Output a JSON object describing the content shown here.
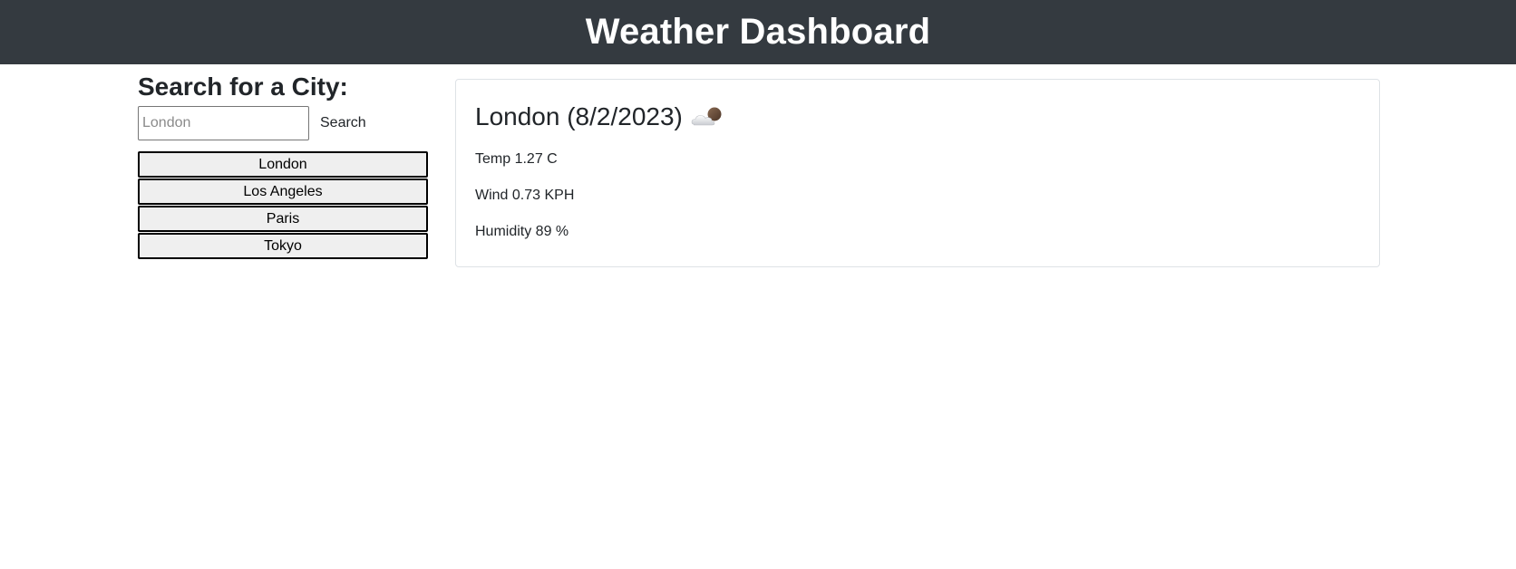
{
  "header": {
    "title": "Weather Dashboard"
  },
  "search": {
    "heading": "Search for a City:",
    "placeholder": "London",
    "button_label": "Search"
  },
  "history": [
    "London",
    "Los Angeles",
    "Paris",
    "Tokyo"
  ],
  "current": {
    "title": "London (8/2/2023)",
    "icon": "partly-cloudy-night-icon",
    "temp": "Temp 1.27 C",
    "wind": "Wind 0.73 KPH",
    "humidity": "Humidity 89 %"
  },
  "colors": {
    "header_bg": "#343a40",
    "card_border": "#dee2e6",
    "history_button_bg": "#efefef"
  }
}
